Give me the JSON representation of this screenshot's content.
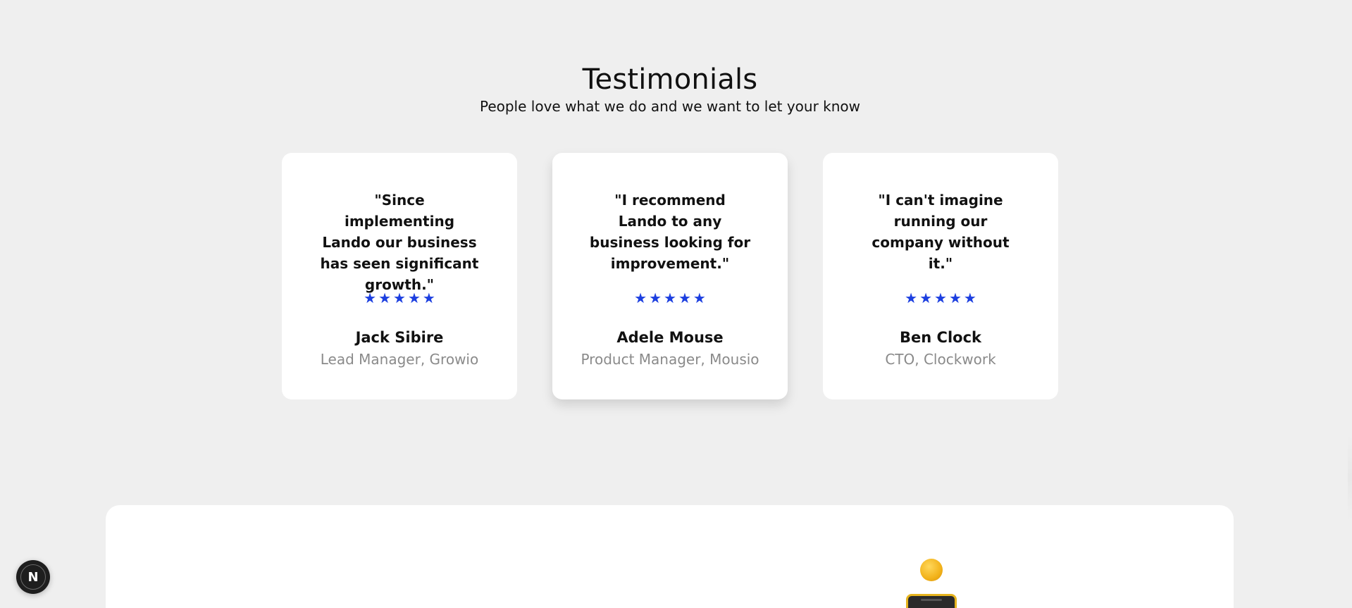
{
  "header": {
    "title": "Testimonials",
    "subtitle": "People love what we do and we want to let your know"
  },
  "testimonials": [
    {
      "quote": "\"Since implementing Lando our business has seen significant growth.\"",
      "rating": 5,
      "name": "Jack Sibire",
      "role": "Lead Manager, Growio"
    },
    {
      "quote": "\"I recommend Lando to any business looking for improvement.\"",
      "rating": 5,
      "name": "Adele Mouse",
      "role": "Product Manager, Mousio"
    },
    {
      "quote": "\"I can't imagine running our company without it.\"",
      "rating": 5,
      "name": "Ben Clock",
      "role": "CTO, Clockwork"
    }
  ],
  "stars": {
    "glyph": "★",
    "color": "#1c3fe0"
  },
  "devtools_badge": {
    "label": "N",
    "icon": "nextjs-icon"
  },
  "colors": {
    "background": "#efefef",
    "card": "#ffffff",
    "accent": "#1c3fe0",
    "muted_text": "#8a8a8a"
  }
}
